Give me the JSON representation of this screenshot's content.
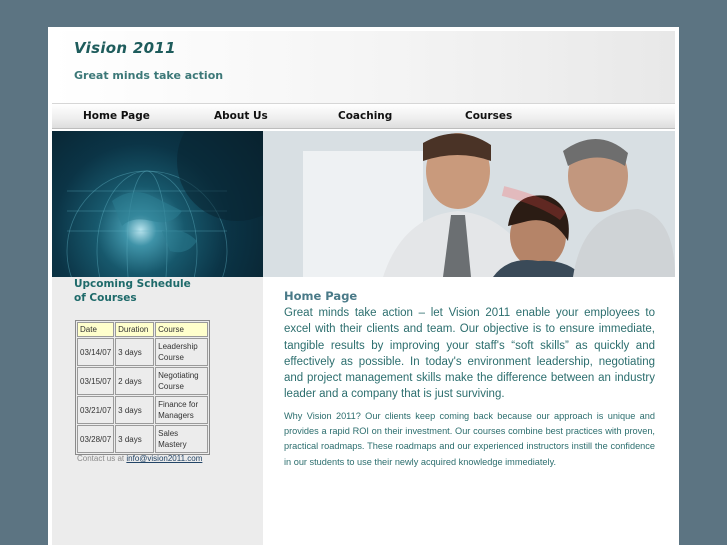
{
  "header": {
    "site_title": "Vision 2011",
    "tagline": "Great minds take action"
  },
  "nav": {
    "items": [
      {
        "label": "Home Page"
      },
      {
        "label": "About Us"
      },
      {
        "label": "Coaching"
      },
      {
        "label": "Courses"
      }
    ]
  },
  "sidebar": {
    "heading_line1": "Upcoming Schedule",
    "heading_line2": "of Courses",
    "table": {
      "headers": [
        "Date",
        "Duration",
        "Course"
      ],
      "rows": [
        [
          "03/14/07",
          "3 days",
          "Leadership Course"
        ],
        [
          "03/15/07",
          "2 days",
          "Negotiating Course"
        ],
        [
          "03/21/07",
          "3 days",
          "Finance for Managers"
        ],
        [
          "03/28/07",
          "3 days",
          "Sales Mastery"
        ]
      ]
    },
    "contact_prefix": "Contact us at",
    "contact_email": "info@vision2011.com"
  },
  "main": {
    "heading": "Home Page",
    "intro": "Great minds take action – let Vision 2011 enable your employees to excel with their clients and team. Our objective is to ensure immediate, tangible results by improving your staff's “soft skills” as quickly and effectively as possible. In today's environment leadership, negotiating and project management skills make the difference between an industry leader and a company that is just surviving.",
    "body": "Why Vision 2011? Our clients keep coming back because our approach is unique and provides a rapid ROI on their investment. Our courses combine best practices with proven, practical roadmaps. These roadmaps and our experienced instructors instill the confidence in our students to use their newly acquired knowledge immediately."
  },
  "colors": {
    "page_bg": "#5c7482",
    "accent_teal": "#1e5c5c",
    "text_teal": "#2c6e6e",
    "table_header_bg": "#ffffcc",
    "sidebar_bg": "#ececec"
  },
  "images": {
    "left_banner": "globe-image",
    "right_banner": "business-team-photo"
  }
}
